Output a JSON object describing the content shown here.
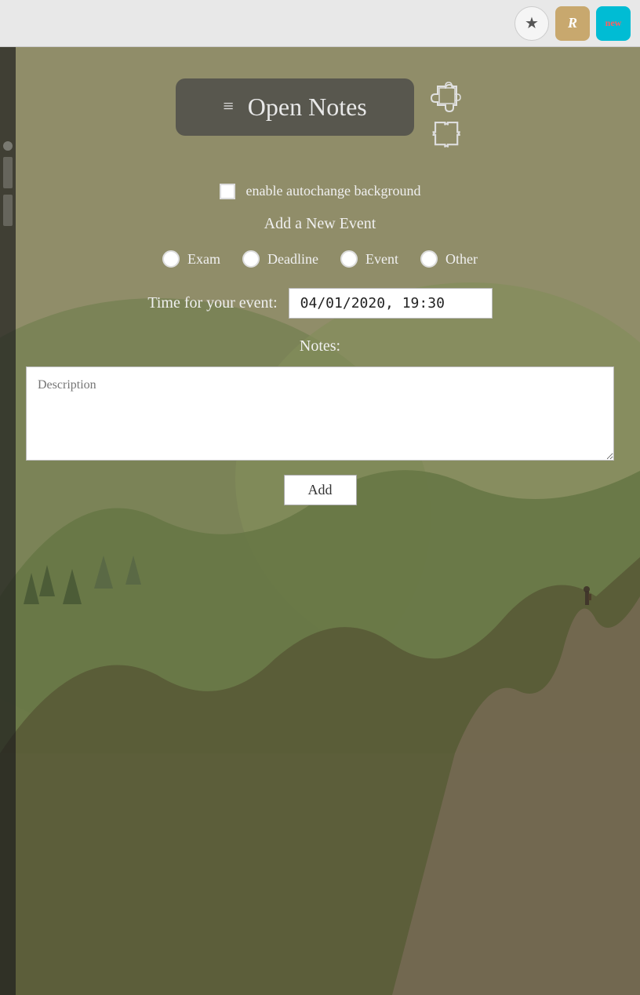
{
  "browser": {
    "star_label": "★",
    "r_button_label": "R",
    "new_button_label": "new"
  },
  "header": {
    "hamburger": "≡",
    "title": "Open Notes",
    "puzzle_icon": "🧩"
  },
  "autochange": {
    "label": "enable autochange background"
  },
  "event_form": {
    "add_event_label": "Add a New Event",
    "radio_options": [
      {
        "id": "exam",
        "label": "Exam"
      },
      {
        "id": "deadline",
        "label": "Deadline"
      },
      {
        "id": "event",
        "label": "Event"
      },
      {
        "id": "other",
        "label": "Other"
      }
    ],
    "time_label": "Time for your event:",
    "time_value": "04/01/2020, 19:30",
    "notes_label": "Notes:",
    "description_placeholder": "Description",
    "add_button_label": "Add"
  }
}
